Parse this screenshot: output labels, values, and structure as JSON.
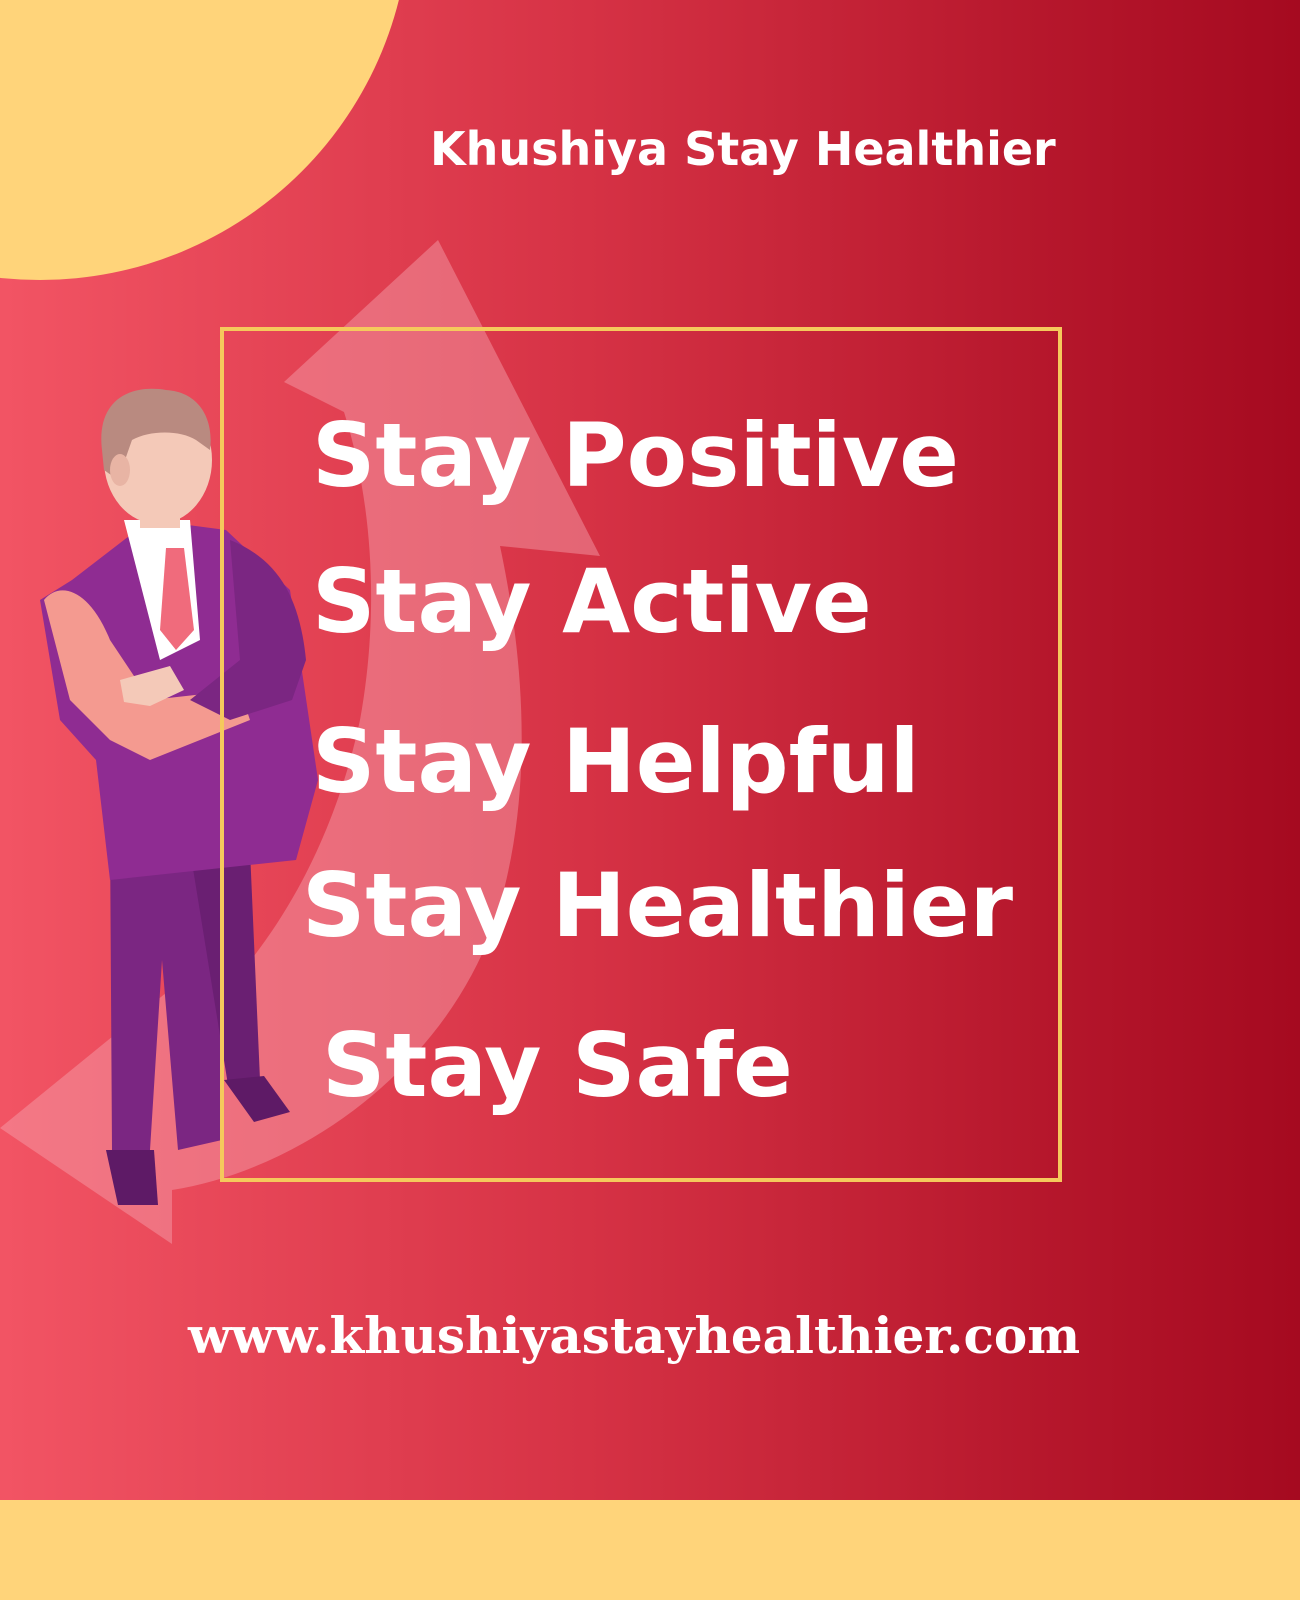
{
  "brand": {
    "title": "Khushiya Stay Healthier"
  },
  "slogans": [
    "Stay Positive",
    "Stay Active",
    "Stay Helpful",
    "Stay Healthier",
    "Stay Safe"
  ],
  "footer": {
    "website": "www.khushiyastayhealthier.com"
  },
  "illustration": {
    "figure": "businessman-arms-crossed",
    "arrow": "curved-up-arrow"
  },
  "colors": {
    "background_start": "#f25464",
    "background_end": "#a50a20",
    "accent_yellow": "#ffd47a",
    "frame_border": "#f5c95c",
    "text": "#ffffff",
    "suit_purple": "#8a2a8e"
  }
}
